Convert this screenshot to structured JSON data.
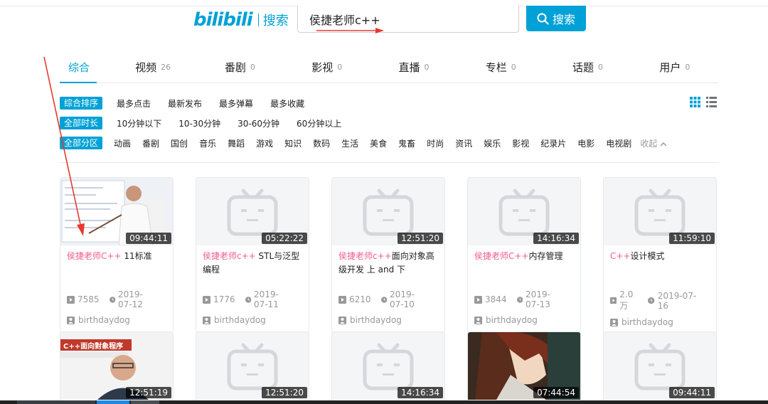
{
  "header": {
    "logo": "bilibili",
    "logo_suffix": "搜索",
    "search_value": "侯捷老师c++",
    "search_button": "搜索"
  },
  "tabs": [
    {
      "label": "综合",
      "count": ""
    },
    {
      "label": "视频",
      "count": "26"
    },
    {
      "label": "番剧",
      "count": "0"
    },
    {
      "label": "影视",
      "count": "0"
    },
    {
      "label": "直播",
      "count": "0"
    },
    {
      "label": "专栏",
      "count": "0"
    },
    {
      "label": "话题",
      "count": "0"
    },
    {
      "label": "用户",
      "count": "0"
    }
  ],
  "filters": {
    "order": {
      "tag": "综合排序",
      "items": [
        "最多点击",
        "最新发布",
        "最多弹幕",
        "最多收藏"
      ]
    },
    "duration": {
      "tag": "全部时长",
      "items": [
        "10分钟以下",
        "10-30分钟",
        "30-60分钟",
        "60分钟以上"
      ]
    },
    "zone": {
      "tag": "全部分区",
      "items": [
        "动画",
        "番剧",
        "国创",
        "音乐",
        "舞蹈",
        "游戏",
        "知识",
        "数码",
        "生活",
        "美食",
        "鬼畜",
        "时尚",
        "资讯",
        "娱乐",
        "影视",
        "纪录片",
        "电影",
        "电视剧"
      ],
      "collapse": "收起"
    }
  },
  "videos": [
    {
      "hl": "侯捷老师C++",
      "rest": " 11标准",
      "duration": "09:44:11",
      "plays": "7585",
      "date": "2019-07-12",
      "up": "birthdaydog"
    },
    {
      "hl": "侯捷老师c++",
      "rest": " STL与泛型编程",
      "duration": "05:22:22",
      "plays": "1776",
      "date": "2019-07-11",
      "up": "birthdaydog"
    },
    {
      "hl": "侯捷老师c++",
      "rest": "面向对象高级开发 上 and 下",
      "duration": "12:51:20",
      "plays": "6210",
      "date": "2019-07-10",
      "up": "birthdaydog"
    },
    {
      "hl": "侯捷老师C++",
      "rest": "内存管理",
      "duration": "14:16:34",
      "plays": "3844",
      "date": "2019-07-13",
      "up": "birthdaydog"
    },
    {
      "hl": "C++",
      "rest": "设计模式",
      "duration": "11:59:10",
      "plays": "2.0万",
      "date": "2019-07-16",
      "up": "birthdaydog"
    }
  ],
  "videos_row2": [
    {
      "duration": "12:51:19",
      "thumb_text": "C++面向對象程序"
    },
    {
      "duration": "12:51:20"
    },
    {
      "duration": "14:16:34"
    },
    {
      "duration": "07:44:54"
    },
    {
      "duration": "09:44:11"
    }
  ],
  "colors": {
    "accent": "#00a1d6",
    "highlight": "#f25d8e",
    "arrow": "#e8382f"
  }
}
